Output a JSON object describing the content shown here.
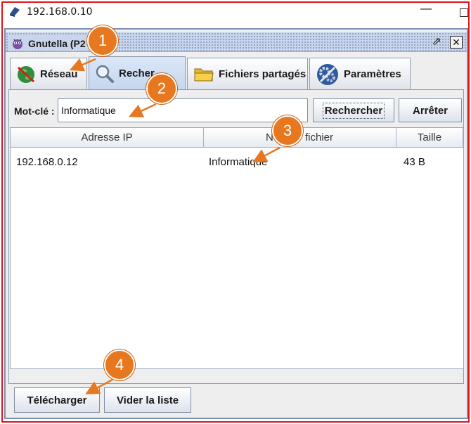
{
  "os_window": {
    "title": "192.168.0.10",
    "minimize_glyph": "—"
  },
  "app_window": {
    "title": "Gnutella (P2",
    "restore_glyph": "⇗",
    "close_glyph": "✕"
  },
  "tabs": [
    {
      "label": "Réseau",
      "icon": "globe-icon"
    },
    {
      "label": "Rechercher",
      "icon": "magnifier-icon",
      "visible_fragment": "Recher"
    },
    {
      "label": "Fichiers partagés",
      "icon": "folder-icon"
    },
    {
      "label": "Paramètres",
      "icon": "gears-icon"
    }
  ],
  "search": {
    "label": "Mot-clé :",
    "value": "Informatique",
    "search_button": "Rechercher",
    "stop_button": "Arrêter"
  },
  "table": {
    "columns": [
      "Adresse IP",
      "N",
      "fichier",
      "Taille"
    ],
    "rows": [
      {
        "ip": "192.168.0.12",
        "name": "Informatique",
        "size": "43 B"
      }
    ]
  },
  "footer": {
    "download_button": "Télécharger",
    "clear_button": "Vider la liste"
  },
  "annotations": [
    "1",
    "2",
    "3",
    "4"
  ],
  "colors": {
    "annotation": "#e7781f",
    "frame": "#e0141c",
    "titlebar": "#c8d5ea"
  }
}
